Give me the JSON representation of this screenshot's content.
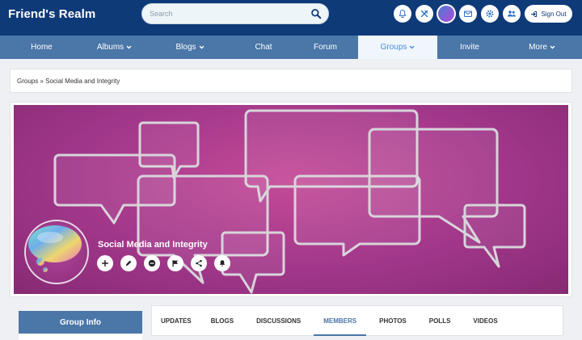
{
  "header": {
    "brand": "Friend's Realm",
    "search_placeholder": "Search",
    "sign_out_label": "Sign Out"
  },
  "nav": {
    "items": [
      {
        "label": "Home",
        "has_dropdown": false,
        "active": false
      },
      {
        "label": "Albums",
        "has_dropdown": true,
        "active": false
      },
      {
        "label": "Blogs",
        "has_dropdown": true,
        "active": false
      },
      {
        "label": "Chat",
        "has_dropdown": false,
        "active": false
      },
      {
        "label": "Forum",
        "has_dropdown": false,
        "active": false
      },
      {
        "label": "Groups",
        "has_dropdown": true,
        "active": true
      },
      {
        "label": "Invite",
        "has_dropdown": false,
        "active": false
      },
      {
        "label": "More",
        "has_dropdown": true,
        "active": false
      }
    ]
  },
  "breadcrumb": {
    "root": "Groups",
    "separator": " » ",
    "current": "Social Media and Integrity"
  },
  "group": {
    "name": "Social Media and Integrity"
  },
  "sidebar": {
    "group_info_label": "Group Info"
  },
  "tabs": [
    {
      "label": "UPDATES",
      "active": false
    },
    {
      "label": "BLOGS",
      "active": false
    },
    {
      "label": "DISCUSSIONS",
      "active": false
    },
    {
      "label": "MEMBERS",
      "active": true
    },
    {
      "label": "PHOTOS",
      "active": false
    },
    {
      "label": "POLLS",
      "active": false
    },
    {
      "label": "VIDEOS",
      "active": false
    }
  ],
  "colors": {
    "header_bg": "#0f3a78",
    "nav_bg": "#4a76a8",
    "nav_active_bg": "#f0f6fb",
    "accent": "#4a8ee0",
    "cover": "#a2378a"
  }
}
